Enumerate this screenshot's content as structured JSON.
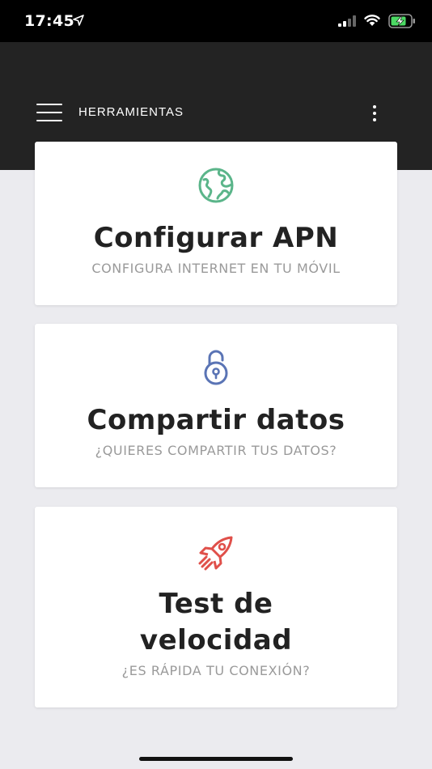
{
  "status_bar": {
    "time": "17:45"
  },
  "header": {
    "title": "HERRAMIENTAS"
  },
  "colors": {
    "header_bg": "#232323",
    "background": "#ebebef",
    "apn_icon": "#5bb58a",
    "share_icon": "#5a74b5",
    "speed_icon": "#e0504a",
    "title": "#222222",
    "subtitle": "#9a9a9a"
  },
  "cards": [
    {
      "icon": "globe-icon",
      "title": "Configurar APN",
      "subtitle": "CONFIGURA INTERNET EN TU MÓVIL"
    },
    {
      "icon": "unlocked-padlock-icon",
      "title": "Compartir datos",
      "subtitle": "¿QUIERES COMPARTIR TUS DATOS?"
    },
    {
      "icon": "rocket-icon",
      "title_line1": "Test de",
      "title_line2": "velocidad",
      "subtitle": "¿ES RÁPIDA TU CONEXIÓN?"
    }
  ]
}
